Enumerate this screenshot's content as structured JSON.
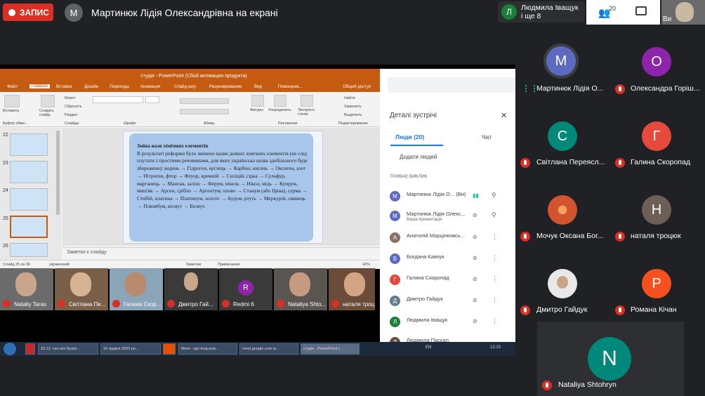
{
  "meet": {
    "recording_label": "ЗАПИС",
    "presenter_initial": "М",
    "presenter_title": "Мартинюк Лідія Олександрівна на екрані",
    "others_name": "Людмила Іващук",
    "others_more": "і ще 8",
    "others_initial": "Л",
    "people_count": "20",
    "self_label": "Ви"
  },
  "ppt": {
    "title": "студія - PowerPoint (Сбой активации продукта)",
    "tabs": [
      "Файл",
      "Главная",
      "Вставка",
      "Дизайн",
      "Переходы",
      "Анимация",
      "Слайд-шоу",
      "Рецензирование",
      "Вид",
      "Помощник...",
      "Общий доступ"
    ],
    "ribbon": {
      "paste": "Вставить",
      "create_slide": "Создать слайд",
      "layout": "Макет",
      "reset": "Сбросить",
      "section": "Раздел",
      "clipboard": "Буфер обме...",
      "slides": "Слайды",
      "font": "Шрифт",
      "paragraph": "Абзац",
      "shapes": "Фигуры",
      "arrange": "Упорядочить",
      "quick_styles": "Экспресс-стили",
      "drawing": "Рисование",
      "find": "Найти",
      "replace": "Заменить",
      "select": "Выделить",
      "editing": "Редактирование"
    },
    "thumb_numbers": [
      "22",
      "23",
      "24",
      "25",
      "26"
    ],
    "slide": {
      "heading": "Зміна назв хімічних елементів",
      "body": "В результаті реформи було змінено назви деяких хімічних елементів (не слід плутати з простими речовинами, для яких українська назва здебільшого буде збережено): водень → Гідроген, вуглець → Карбон, кисень → Оксиген, азот → Нітроген, фтор → Флуор, кремній → Силіцій, сірка → Сульфур, марганець → Манган, залізо → Ферум, нікель → Нікол, мідь → Купрум, миш'як → Арсен, срібло → Аргентум, олово → Станум (або Цина), сурма → Стибій, платина → Платинум, золото → Аурум, ртуть → Меркурій, свинець → Плюмбум, вісмут → Бісмут."
    },
    "notes_placeholder": "Заметки к слайду",
    "status": {
      "slide": "Слайд 25 из 36",
      "lang": "украинский",
      "notes": "Заметки",
      "comments": "Примечания",
      "zoom": "42%"
    }
  },
  "panel": {
    "title": "Деталі зустрічі",
    "tab_people": "Люди (20)",
    "tab_chat": "Чат",
    "add_people": "Додати людей",
    "call_section": "ТРИВАЄ ВИКЛИК",
    "participants": [
      {
        "initial": "М",
        "name": "Мартинюк Лідія О... (Ви)",
        "sub": "",
        "color": "#5c6bc0"
      },
      {
        "initial": "М",
        "name": "Мартинюк Лідія Олекс...",
        "sub": "Ваша презентація",
        "color": "#5c6bc0"
      },
      {
        "initial": "А",
        "name": "Анатолій Марцінковсь...",
        "sub": "",
        "color": "#8d6e63"
      },
      {
        "initial": "Б",
        "name": "Богдана Кавчук",
        "sub": "",
        "color": "#5c6bc0"
      },
      {
        "initial": "Г",
        "name": "Галина Скоропад",
        "sub": "",
        "color": "#e8453c"
      },
      {
        "initial": "Д",
        "name": "Дмитро Гайдук",
        "sub": "",
        "color": "#607d8b"
      },
      {
        "initial": "Л",
        "name": "Людмила Іващук",
        "sub": "",
        "color": "#188038"
      },
      {
        "initial": "Л",
        "name": "Людмила Паскал",
        "sub": "",
        "color": "#6d4c41"
      }
    ]
  },
  "filmstrip": [
    {
      "name": "Nataliy Taras",
      "bg": "#6b6b6b",
      "face": "#c9a58c"
    },
    {
      "name": "Світлана Пе...",
      "bg": "#7a5f48",
      "face": "#d6b393"
    },
    {
      "name": "Галина Скор...",
      "bg": "#8aa5b8",
      "face": "#b88a6e"
    },
    {
      "name": "Дмитро Гай...",
      "bg": "#3a3a3a",
      "face": "#c8a78a"
    },
    {
      "name": "Redmi 6",
      "bg": "#3a3a3a",
      "face": ""
    },
    {
      "name": "Nataliya Shto...",
      "bg": "#5a5550",
      "face": "#c59a80"
    },
    {
      "name": "наталя троц...",
      "bg": "#6b4b3a",
      "face": "#d4a584"
    }
  ],
  "filmstrip_redmi_initial": "R",
  "taskbar": {
    "items": [
      "16.12. скл-зол Бухгр...",
      "16 грудня 2020 ро...",
      "",
      "Meet - ugc-kvaj-yuw...",
      "meet.google.com w...",
      "студія - PowerPoint (..."
    ],
    "lang": "EN",
    "time": "12:10"
  },
  "tiles": [
    {
      "initial": "М",
      "name": "Мартинюк Лідія О...",
      "color": "#5c6bc0",
      "muted": false
    },
    {
      "initial": "О",
      "name": "Олександра Горіш...",
      "color": "#8e24aa",
      "muted": true
    },
    {
      "initial": "С",
      "name": "Світлана Переясл...",
      "color": "#00897b",
      "muted": true
    },
    {
      "initial": "Г",
      "name": "Галина Скоропад",
      "color": "#e64a3c",
      "muted": true
    },
    {
      "initial": "",
      "name": "Мочук Оксана Бог...",
      "color": "#d4532f",
      "muted": true
    },
    {
      "initial": "Н",
      "name": "наталя троцюк",
      "color": "#6d5f55",
      "muted": true
    },
    {
      "initial": "",
      "name": "Дмитро Гайдук",
      "color": "#e8e8e8",
      "muted": true
    },
    {
      "initial": "Р",
      "name": "Романа Кічан",
      "color": "#f4511e",
      "muted": true
    }
  ],
  "bottom_tile": {
    "initial": "N",
    "name": "Nataliya Shtohryn",
    "color": "#00897b"
  }
}
